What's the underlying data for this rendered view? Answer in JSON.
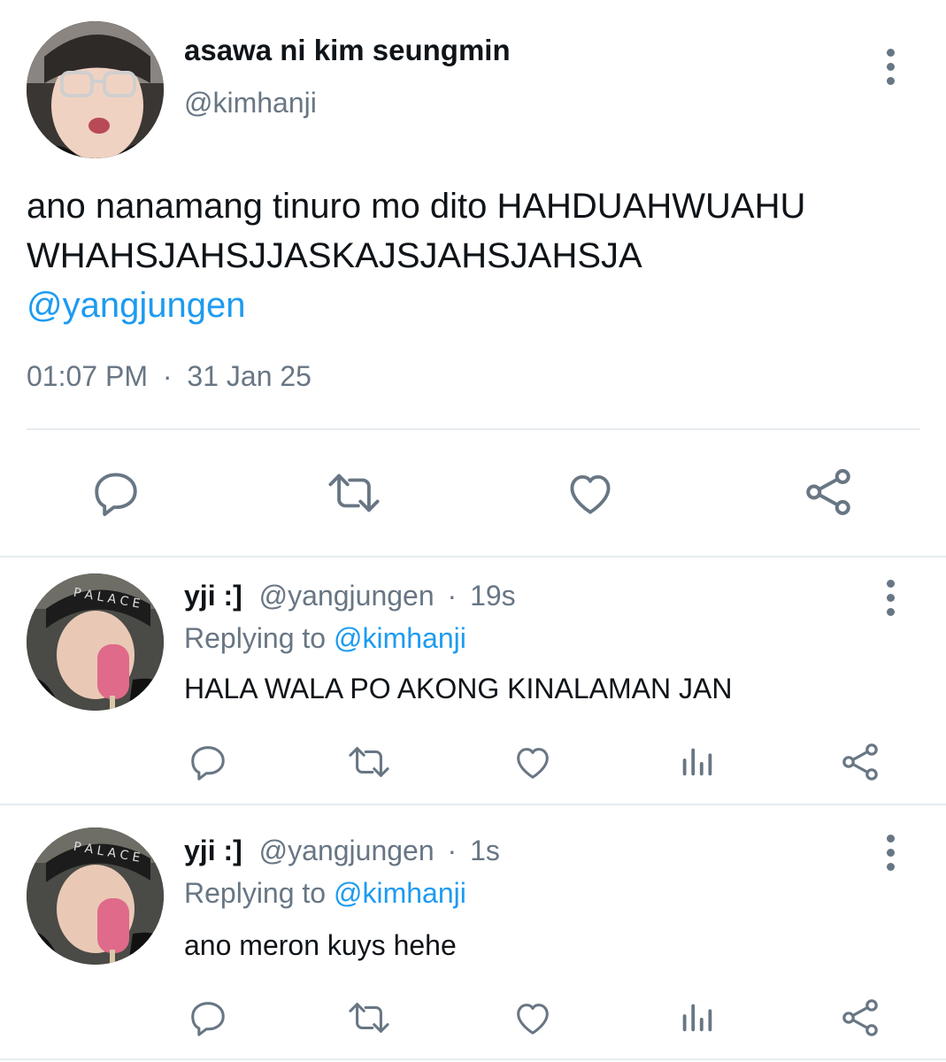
{
  "main_tweet": {
    "display_name": "asawa ni kim seungmin",
    "handle": "@kimhanji",
    "text_line1": "ano nanamang tinuro mo dito HAHDUAHWUAHU",
    "text_line2": "WHAHSJAHSJJASKAJSJAHSJAHSJA",
    "mention": "@yangjungen",
    "time": "01:07 PM",
    "separator": "·",
    "date": "31 Jan 25",
    "actions": [
      "reply-icon",
      "retweet-icon",
      "like-icon",
      "share-icon"
    ]
  },
  "replies": [
    {
      "display_name": "yji :]",
      "handle": "@yangjungen",
      "separator": "·",
      "time": "19s",
      "replying_prefix": "Replying to",
      "replying_to": "@kimhanji",
      "text": "HALA WALA PO AKONG KINALAMAN JAN",
      "actions": [
        "reply-icon",
        "retweet-icon",
        "like-icon",
        "analytics-icon",
        "share-icon"
      ]
    },
    {
      "display_name": "yji :]",
      "handle": "@yangjungen",
      "separator": "·",
      "time": "1s",
      "replying_prefix": "Replying to",
      "replying_to": "@kimhanji",
      "text": "ano meron kuys hehe",
      "actions": [
        "reply-icon",
        "retweet-icon",
        "like-icon",
        "analytics-icon",
        "share-icon"
      ]
    }
  ],
  "colors": {
    "text": "#0f1419",
    "muted": "#687684",
    "link": "#1d9bf0",
    "icon": "#687684",
    "divider": "#e6ecf0"
  }
}
